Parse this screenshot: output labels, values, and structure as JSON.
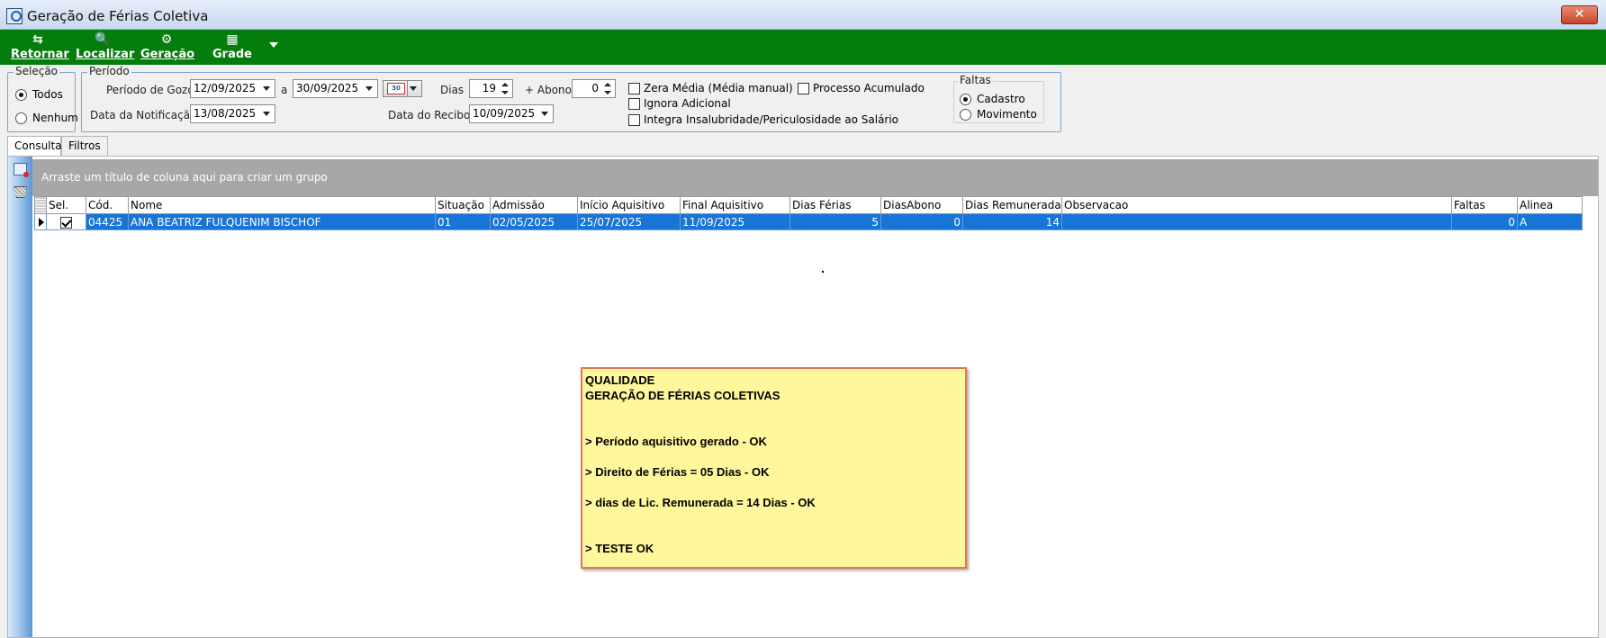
{
  "window": {
    "title": "Geração de Férias Coletiva",
    "close_label": "✕"
  },
  "toolbar": {
    "buttons": [
      {
        "label": "Retornar",
        "icon": "return-icon"
      },
      {
        "label": "Localizar",
        "icon": "search-icon"
      },
      {
        "label": "Geração",
        "icon": "gear-icon"
      },
      {
        "label": "Grade",
        "icon": "grid-icon"
      }
    ]
  },
  "selecao": {
    "title": "Seleção",
    "options": [
      {
        "label": "Todos",
        "checked": true
      },
      {
        "label": "Nenhum",
        "checked": false
      }
    ]
  },
  "periodo": {
    "title": "Período",
    "gozo_label": "Período de Gozo",
    "gozo_start": "12/09/2025",
    "separator": "a",
    "gozo_end": "30/09/2025",
    "dias_label": "Dias",
    "dias_value": "19",
    "abono_label": "+ Abono",
    "abono_value": "0",
    "notificacao_label": "Data da Notificação",
    "notificacao_value": "13/08/2025",
    "recibo_label": "Data do Recibo",
    "recibo_value": "10/09/2025",
    "calendar_text": "30",
    "checks": [
      {
        "label": "Zera Média (Média manual)",
        "checked": false
      },
      {
        "label": "Ignora Adicional",
        "checked": false
      },
      {
        "label": "Integra Insalubridade/Periculosidade ao Salário",
        "checked": false
      },
      {
        "label": "Processo Acumulado",
        "checked": false
      }
    ]
  },
  "faltas": {
    "title": "Faltas",
    "options": [
      {
        "label": "Cadastro",
        "checked": true
      },
      {
        "label": "Movimento",
        "checked": false
      }
    ]
  },
  "tabs": [
    {
      "label": "Consulta",
      "active": true
    },
    {
      "label": "Filtros",
      "active": false
    }
  ],
  "grid": {
    "group_hint": "Arraste um título de coluna aqui para criar um grupo",
    "columns": [
      "Sel.",
      "Cód.",
      "Nome",
      "Situação",
      "Admissão",
      "Início Aquisitivo",
      "Final Aquisitivo",
      "Dias Férias",
      "DiasAbono",
      "Dias Remunerada",
      "Observacao",
      "Faltas",
      "Alinea"
    ],
    "rows": [
      {
        "sel": true,
        "cod": "04425",
        "nome": "ANA BEATRIZ FULQUENIM BISCHOF",
        "situacao": "01",
        "admissao": "02/05/2025",
        "inicio": "25/07/2025",
        "final": "11/09/2025",
        "dias_ferias": "5",
        "dias_abono": "0",
        "dias_remunerada": "14",
        "observacao": "",
        "faltas": "0",
        "alinea": "A"
      }
    ]
  },
  "note": {
    "lines": [
      "QUALIDADE",
      "GERAÇÃO DE FÉRIAS COLETIVAS",
      "",
      "",
      "> Período aquisitivo gerado - OK",
      "",
      "> Direito de Férias = 05 Dias - OK",
      "",
      "> dias de Lic. Remunerada = 14 Dias - OK",
      "",
      "",
      "> TESTE OK"
    ]
  },
  "colors": {
    "toolbar": "#047d0c",
    "selection": "#1874d7",
    "note_bg": "#fff79c",
    "note_border": "#e1775c"
  }
}
